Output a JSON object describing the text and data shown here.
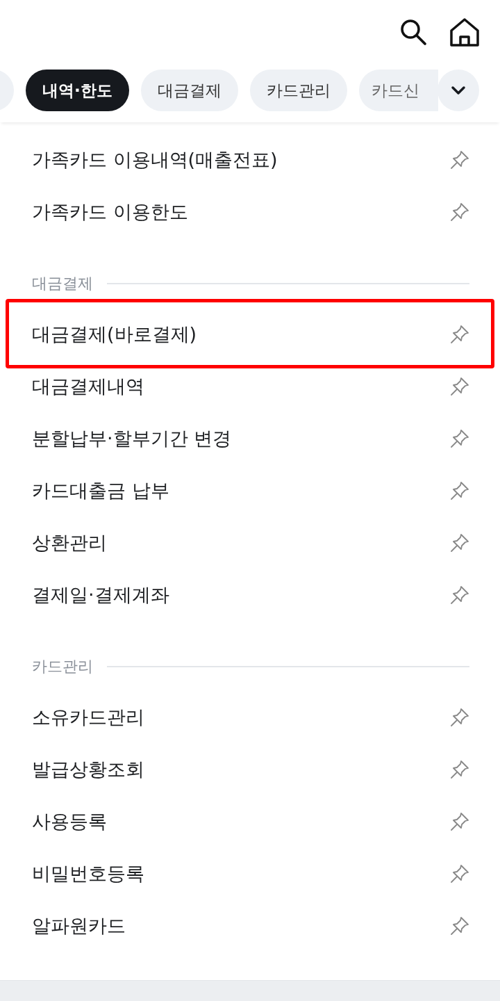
{
  "header": {
    "actions": [
      {
        "kind": "search"
      },
      {
        "kind": "home"
      }
    ]
  },
  "tabs": [
    {
      "selected": false
    },
    {
      "label": "내역·한도",
      "selected": true
    },
    {
      "label": "대금결제",
      "selected": false
    },
    {
      "label": "카드관리",
      "selected": false
    },
    {
      "label": "카드신",
      "selected": false
    }
  ],
  "sections": [
    {
      "items": [
        {
          "label": "가족카드 이용내역(매출전표)",
          "highlighted": false
        },
        {
          "label": "가족카드 이용한도",
          "highlighted": false
        }
      ]
    },
    {
      "title": "대금결제",
      "items": [
        {
          "label": "대금결제(바로결제)",
          "highlighted": true
        },
        {
          "label": "대금결제내역",
          "highlighted": false
        },
        {
          "label": "분할납부·할부기간 변경",
          "highlighted": false
        },
        {
          "label": "카드대출금 납부",
          "highlighted": false
        },
        {
          "label": "상환관리",
          "highlighted": false
        },
        {
          "label": "결제일·결제계좌",
          "highlighted": false
        }
      ]
    },
    {
      "title": "카드관리",
      "items": [
        {
          "label": "소유카드관리",
          "highlighted": false
        },
        {
          "label": "발급상황조회",
          "highlighted": false
        },
        {
          "label": "사용등록",
          "highlighted": false
        },
        {
          "label": "비밀번호등록",
          "highlighted": false
        },
        {
          "label": "알파원카드",
          "highlighted": false
        }
      ]
    }
  ]
}
